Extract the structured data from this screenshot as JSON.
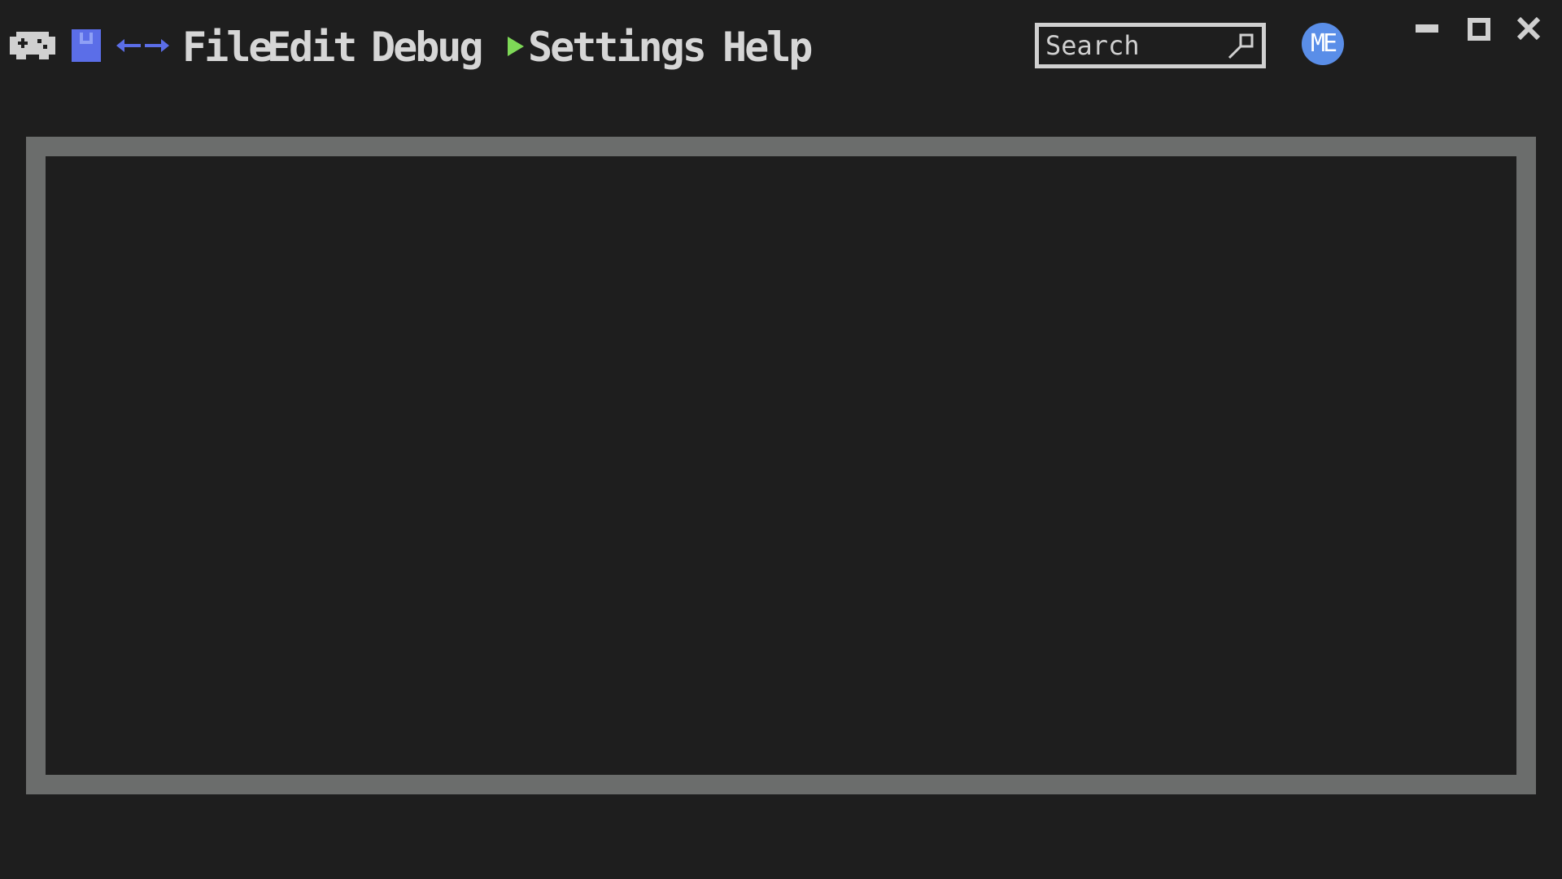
{
  "toolbar": {
    "icons": {
      "logo": "gamepad-icon",
      "save": "floppy-disk-icon",
      "back": "arrow-left-icon",
      "forward": "arrow-right-icon",
      "run": "play-icon"
    },
    "menu": {
      "file": "File",
      "edit": "Edit",
      "debug": "Debug",
      "settings": "Settings",
      "help": "Help"
    },
    "search": {
      "placeholder": "Search",
      "icon": "search-icon"
    },
    "avatar": {
      "initials": "ME"
    },
    "window_controls": {
      "minimize": "minimize-icon",
      "maximize": "maximize-icon",
      "close": "close-icon"
    }
  },
  "colors": {
    "background": "#1e1e1e",
    "menu_text": "#d6d6d6",
    "accent_blue": "#5b6ee8",
    "avatar": "#5a8ee8",
    "run_green": "#7ed957",
    "panel_border": "#6b6d6c"
  }
}
